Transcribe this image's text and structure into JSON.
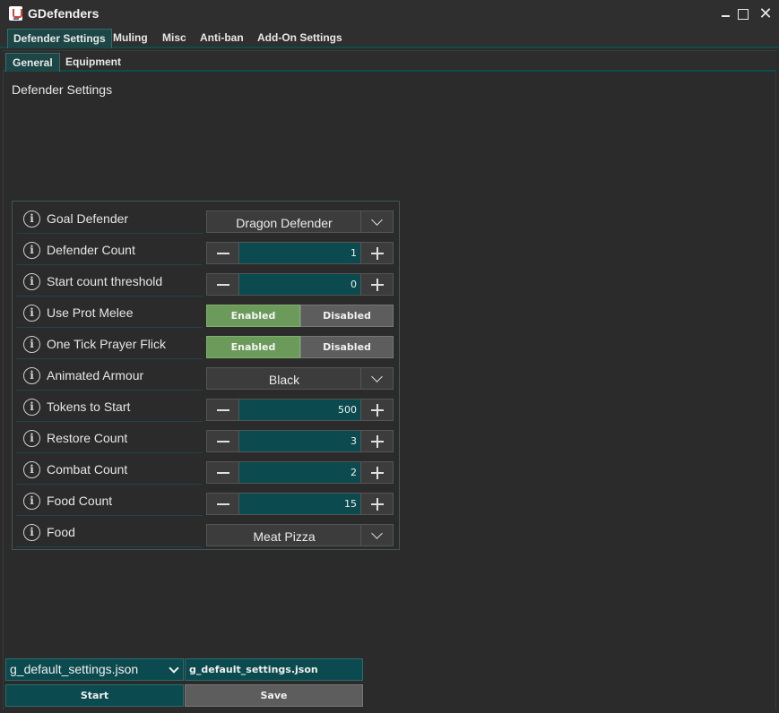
{
  "window": {
    "title": "GDefenders"
  },
  "main_tabs": [
    {
      "label": "Defender Settings",
      "active": true
    },
    {
      "label": "Muling",
      "active": false
    },
    {
      "label": "Misc",
      "active": false
    },
    {
      "label": "Anti-ban",
      "active": false
    },
    {
      "label": "Add-On Settings",
      "active": false
    }
  ],
  "sub_tabs": [
    {
      "label": "General",
      "active": true
    },
    {
      "label": "Equipment",
      "active": false
    }
  ],
  "section_title": "Defender Settings",
  "settings": [
    {
      "label": "Goal Defender",
      "type": "dropdown",
      "value": "Dragon Defender"
    },
    {
      "label": "Defender Count",
      "type": "stepper",
      "value": "1"
    },
    {
      "label": "Start count threshold",
      "type": "stepper",
      "value": "0"
    },
    {
      "label": "Use Prot Melee",
      "type": "toggle",
      "on_label": "Enabled",
      "off_label": "Disabled",
      "selected": "Enabled"
    },
    {
      "label": "One Tick Prayer Flick",
      "type": "toggle",
      "on_label": "Enabled",
      "off_label": "Disabled",
      "selected": "Enabled"
    },
    {
      "label": "Animated Armour",
      "type": "dropdown",
      "value": "Black"
    },
    {
      "label": "Tokens to Start",
      "type": "stepper",
      "value": "500"
    },
    {
      "label": "Restore Count",
      "type": "stepper",
      "value": "3"
    },
    {
      "label": "Combat Count",
      "type": "stepper",
      "value": "2"
    },
    {
      "label": "Food Count",
      "type": "stepper",
      "value": "15"
    },
    {
      "label": "Food",
      "type": "dropdown",
      "value": "Meat Pizza"
    }
  ],
  "footer": {
    "settings_file_select": "g_default_settings.json",
    "settings_file_name": "g_default_settings.json",
    "start_label": "Start",
    "save_label": "Save"
  },
  "colors": {
    "accent_teal": "#0b4a4e",
    "enabled_green": "#6b9a5b",
    "disabled_gray": "#5d5d5d",
    "background": "#2b2b2b"
  },
  "icons": [
    "java-app-icon",
    "minimize-icon",
    "maximize-icon",
    "close-icon",
    "info-icon",
    "chevron-down-icon",
    "minus-icon",
    "plus-icon"
  ]
}
